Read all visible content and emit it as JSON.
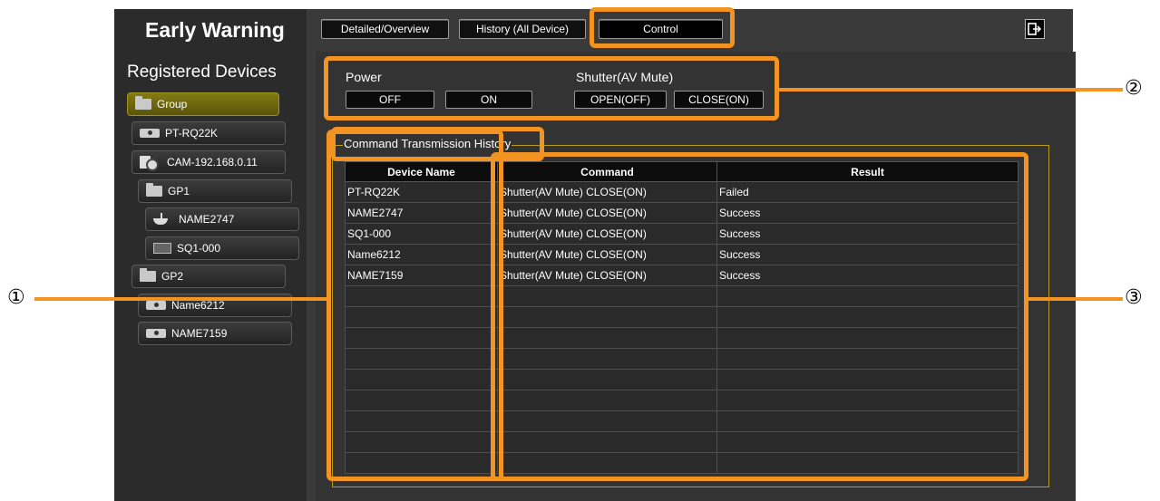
{
  "header": {
    "title": "Early Warning",
    "tabs": [
      {
        "label": "Detailed/Overview"
      },
      {
        "label": "History (All Device)"
      },
      {
        "label": "Control"
      }
    ],
    "logout_icon": "logout-icon"
  },
  "sidebar": {
    "title": "Registered Devices",
    "items": [
      {
        "label": "Group",
        "icon": "folder-icon"
      },
      {
        "label": "PT-RQ22K",
        "icon": "projector-icon"
      },
      {
        "label": "CAM-192.168.0.11",
        "icon": "camera-icon"
      },
      {
        "label": "GP1",
        "icon": "folder-icon"
      },
      {
        "label": "NAME2747",
        "icon": "dome-camera-icon"
      },
      {
        "label": "SQ1-000",
        "icon": "display-icon"
      },
      {
        "label": "GP2",
        "icon": "folder-icon"
      },
      {
        "label": "Name6212",
        "icon": "projector-icon"
      },
      {
        "label": "NAME7159",
        "icon": "projector-icon"
      }
    ]
  },
  "controls": {
    "power_label": "Power",
    "power_off": "OFF",
    "power_on": "ON",
    "shutter_label": "Shutter(AV Mute)",
    "shutter_open": "OPEN(OFF)",
    "shutter_close": "CLOSE(ON)"
  },
  "history": {
    "title": "Command Transmission History",
    "columns": [
      "Device Name",
      "Command",
      "Result"
    ],
    "rows": [
      {
        "device": "PT-RQ22K",
        "command": "Shutter(AV Mute) CLOSE(ON)",
        "result": "Failed"
      },
      {
        "device": "NAME2747",
        "command": "Shutter(AV Mute) CLOSE(ON)",
        "result": "Success"
      },
      {
        "device": "SQ1-000",
        "command": "Shutter(AV Mute) CLOSE(ON)",
        "result": "Success"
      },
      {
        "device": "Name6212",
        "command": "Shutter(AV Mute) CLOSE(ON)",
        "result": "Success"
      },
      {
        "device": "NAME7159",
        "command": "Shutter(AV Mute) CLOSE(ON)",
        "result": "Success"
      },
      {
        "device": "",
        "command": "",
        "result": ""
      },
      {
        "device": "",
        "command": "",
        "result": ""
      },
      {
        "device": "",
        "command": "",
        "result": ""
      },
      {
        "device": "",
        "command": "",
        "result": ""
      },
      {
        "device": "",
        "command": "",
        "result": ""
      },
      {
        "device": "",
        "command": "",
        "result": ""
      },
      {
        "device": "",
        "command": "",
        "result": ""
      },
      {
        "device": "",
        "command": "",
        "result": ""
      },
      {
        "device": "",
        "command": "",
        "result": ""
      }
    ]
  },
  "callouts": [
    "①",
    "②",
    "③"
  ],
  "colors": {
    "highlight": "#f39422",
    "selected_item": "#7a7210",
    "frame": "#b89a1e",
    "background": "#3a3a3a"
  }
}
